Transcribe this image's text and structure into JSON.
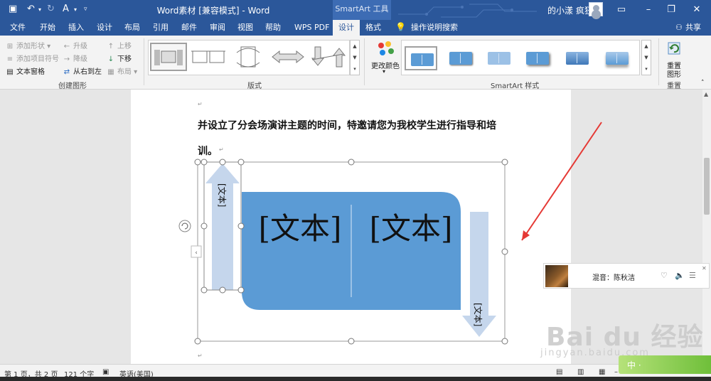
{
  "titlebar": {
    "doc_title": "Word素材 [兼容模式] - Word",
    "smartart_tools": "SmartArt 工具",
    "user_name": "的小漾 疯狂",
    "colors": {
      "bar": "#2b579a",
      "contextual": "#3d6cb4"
    }
  },
  "tabs": [
    {
      "label": "文件"
    },
    {
      "label": "开始"
    },
    {
      "label": "插入"
    },
    {
      "label": "设计"
    },
    {
      "label": "布局"
    },
    {
      "label": "引用"
    },
    {
      "label": "邮件"
    },
    {
      "label": "审阅"
    },
    {
      "label": "视图"
    },
    {
      "label": "帮助"
    },
    {
      "label": "WPS PDF"
    },
    {
      "label": "设计"
    },
    {
      "label": "格式"
    }
  ],
  "tell_me": "操作说明搜索",
  "share": "共享",
  "ribbon": {
    "create_graphic": {
      "label": "创建图形",
      "add_shape": "添加形状",
      "add_bullet": "添加项目符号",
      "text_pane": "文本窗格",
      "promote": "升级",
      "demote": "降级",
      "right_to_left": "从右到左",
      "move_up": "上移",
      "move_down": "下移",
      "layout": "布局"
    },
    "layouts": {
      "label": "版式"
    },
    "styles": {
      "label": "SmartArt 样式",
      "change_colors": "更改颜色"
    },
    "reset": {
      "label": "重置",
      "reset_graphic_line1": "重置",
      "reset_graphic_line2": "图形"
    }
  },
  "document": {
    "para1": "并设立了分会场演讲主题的时间，特邀请您为我校学生进行指导和培",
    "para2": "训。",
    "smartart": {
      "text_left": "[文本]",
      "text_right": "[文本]",
      "arrow_up_text": "[文本]",
      "arrow_down_text": "[文本]",
      "colors": {
        "fill": "#5b9bd5",
        "arrow": "#c5d6ec",
        "annotation": "#e53935"
      }
    }
  },
  "statusbar": {
    "page": "第 1 页，共 2 页",
    "words": "121 个字",
    "language": "英语(美国)"
  },
  "music_popup": {
    "title": "混音：陈秋洁"
  },
  "watermark": {
    "logo": "Bai du 经验",
    "url": "jingyan.baidu.com"
  },
  "ime_bar": {
    "text": "中 ·"
  }
}
